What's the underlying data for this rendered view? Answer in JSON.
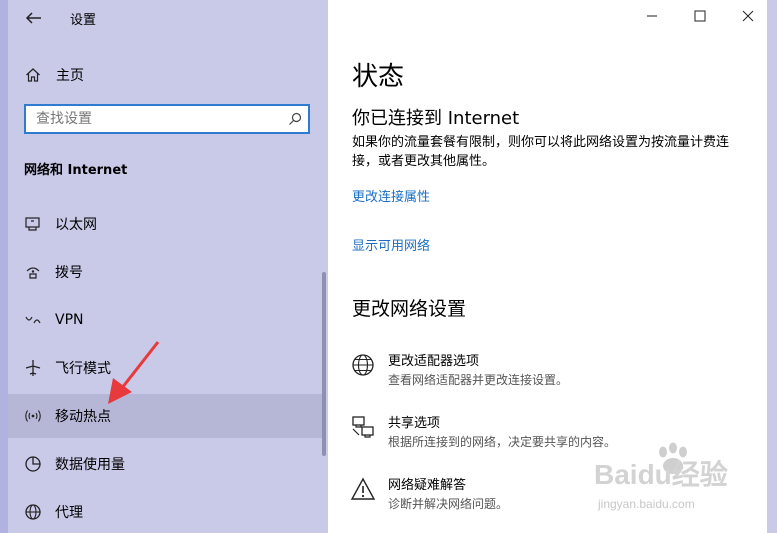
{
  "window": {
    "title": "设置",
    "controls": {
      "minimize": "minimize-icon",
      "maximize": "maximize-icon",
      "close": "close-icon"
    }
  },
  "sidebar": {
    "home_label": "主页",
    "search": {
      "placeholder": "查找设置",
      "value": ""
    },
    "section_title": "网络和 Internet",
    "items": [
      {
        "label": "以太网",
        "icon": "ethernet-icon"
      },
      {
        "label": "拨号",
        "icon": "dialup-icon"
      },
      {
        "label": "VPN",
        "icon": "vpn-icon"
      },
      {
        "label": "飞行模式",
        "icon": "airplane-icon"
      },
      {
        "label": "移动热点",
        "icon": "hotspot-icon",
        "selected": true
      },
      {
        "label": "数据使用量",
        "icon": "data-usage-icon"
      },
      {
        "label": "代理",
        "icon": "proxy-icon"
      }
    ]
  },
  "main": {
    "page_title": "状态",
    "connection_heading": "你已连接到 Internet",
    "description": "如果你的流量套餐有限制，则你可以将此网络设置为按流量计费连接，或者更改其他属性。",
    "links": {
      "change_properties": "更改连接属性",
      "show_networks": "显示可用网络"
    },
    "change_settings_heading": "更改网络设置",
    "options": [
      {
        "title": "更改适配器选项",
        "desc": "查看网络适配器并更改连接设置。",
        "icon": "adapter-icon"
      },
      {
        "title": "共享选项",
        "desc": "根据所连接到的网络，决定要共享的内容。",
        "icon": "sharing-icon"
      },
      {
        "title": "网络疑难解答",
        "desc": "诊断并解决网络问题。",
        "icon": "warning-icon"
      }
    ]
  },
  "watermark": {
    "brand": "Baidu经验",
    "url": "jingyan.baidu.com"
  },
  "colors": {
    "sidebar_bg": "#c9c9e8",
    "selected_bg": "#b6b6d6",
    "link": "#1b6ec2",
    "arrow": "#e8393c",
    "search_border": "#2f7bd2"
  }
}
